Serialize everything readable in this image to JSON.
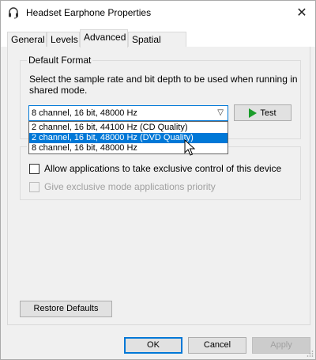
{
  "window": {
    "title": "Headset Earphone Properties",
    "icon": "headset-icon",
    "close_symbol": "✕"
  },
  "tabs": [
    {
      "label": "General",
      "active": false
    },
    {
      "label": "Levels",
      "active": false
    },
    {
      "label": "Advanced",
      "active": true
    },
    {
      "label": "Spatial sound",
      "active": false
    }
  ],
  "default_format": {
    "legend": "Default Format",
    "description": "Select the sample rate and bit depth to be used when running in shared mode.",
    "selected": "8 channel, 16 bit, 48000 Hz",
    "options": [
      "2 channel, 16 bit, 44100 Hz (CD Quality)",
      "2 channel, 16 bit, 48000 Hz (DVD Quality)",
      "8 channel, 16 bit, 48000 Hz"
    ],
    "highlighted_index": 1,
    "test_label": "Test"
  },
  "exclusive": {
    "legend_visible": "E",
    "allow_label": "Allow applications to take exclusive control of this device",
    "allow_checked": false,
    "priority_label": "Give exclusive mode applications priority",
    "priority_checked": false,
    "priority_enabled": false
  },
  "restore_label": "Restore Defaults",
  "footer": {
    "ok": "OK",
    "cancel": "Cancel",
    "apply": "Apply"
  },
  "colors": {
    "accent": "#0078d7",
    "play": "#1a9c2a"
  }
}
